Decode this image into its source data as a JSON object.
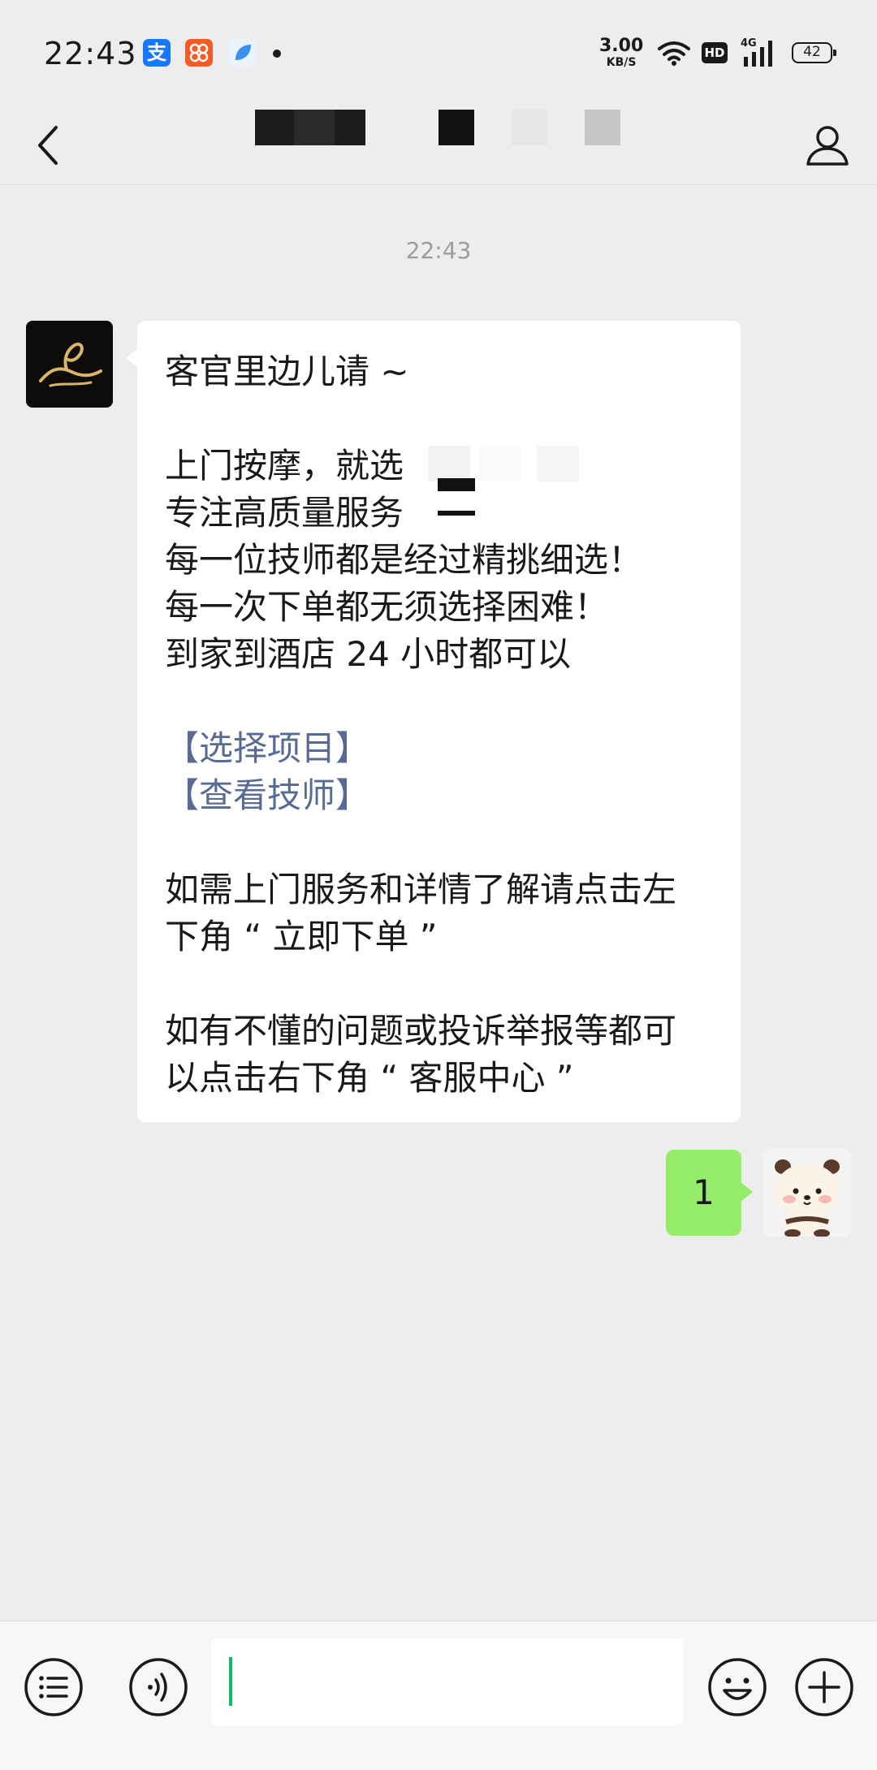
{
  "status_bar": {
    "time": "22:43",
    "apps": [
      {
        "icon": "alipay-icon",
        "glyph": "支",
        "color": "#1677ff"
      },
      {
        "icon": "taobao-style-app-icon",
        "glyph": "",
        "color": "#f35c25"
      },
      {
        "icon": "blue-leaf-app-icon",
        "glyph": "",
        "color": "#3a8ff0"
      }
    ],
    "net_speed_value": "3.00",
    "net_speed_unit": "KB/S",
    "hd_label": "HD",
    "network_label": "4G",
    "battery": "42"
  },
  "header": {
    "back_icon": "chevron-left-icon",
    "title_redacted": true,
    "profile_icon": "person-icon"
  },
  "chat": {
    "timestamp": "22:43",
    "incoming": {
      "avatar": "brand-logo-avatar",
      "lines": [
        {
          "text": "客官里边儿请 ~"
        },
        {
          "text": ""
        },
        {
          "text": "上门按摩，就选"
        },
        {
          "text": "专注高质量服务"
        },
        {
          "text": "每一位技师都是经过精挑细选！"
        },
        {
          "text": "每一次下单都无须选择困难！"
        },
        {
          "text": "到家到酒店 24 小时都可以"
        },
        {
          "text": ""
        },
        {
          "text": "【选择项目】",
          "link": true
        },
        {
          "text": "【查看技师】",
          "link": true
        },
        {
          "text": ""
        },
        {
          "text": "如需上门服务和详情了解请点击左"
        },
        {
          "text": "下角 “ 立即下单 ”"
        },
        {
          "text": ""
        },
        {
          "text": "如有不懂的问题或投诉举报等都可"
        },
        {
          "text": "以点击右下角 “ 客服中心 ”"
        }
      ]
    },
    "outgoing": {
      "text": "1",
      "avatar": "bear-sticker-avatar"
    }
  },
  "bottom_bar": {
    "menu_icon": "list-menu-icon",
    "voice_icon": "voice-icon",
    "input_value": "",
    "emoji_icon": "emoji-icon",
    "plus_icon": "plus-icon"
  },
  "colors": {
    "background": "#ededed",
    "incoming_bubble": "#ffffff",
    "outgoing_bubble": "#95ec69",
    "link": "#576b95",
    "caret": "#07c160"
  }
}
